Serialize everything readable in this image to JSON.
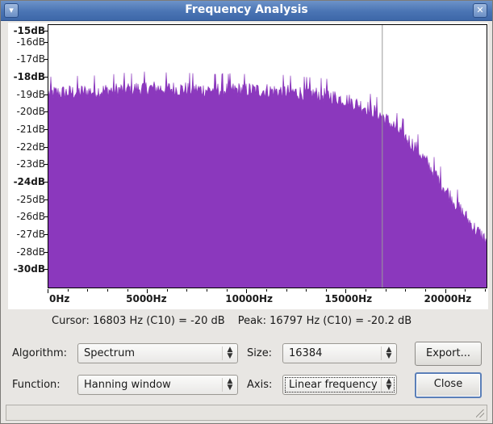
{
  "window": {
    "title": "Frequency Analysis",
    "menu_icon": "window-menu-icon",
    "close_glyph": "✕"
  },
  "chart_data": {
    "type": "area",
    "title": "",
    "xlabel": "",
    "ylabel": "",
    "xlim": [
      0,
      22050
    ],
    "ylim": [
      -30,
      -15
    ],
    "series_color": "#8b38bd",
    "cursor_line_hz": 16803,
    "x_tick_labels": [
      "0Hz",
      "5000Hz",
      "10000Hz",
      "15000Hz",
      "20000Hz"
    ],
    "x_tick_values": [
      0,
      5000,
      10000,
      15000,
      20000
    ],
    "y_tick_labels": [
      "-15dB",
      "-16dB",
      "-17dB",
      "-18dB",
      "-19dB",
      "-20dB",
      "-21dB",
      "-22dB",
      "-23dB",
      "-24dB",
      "-25dB",
      "-26dB",
      "-27dB",
      "-28dB",
      "-30dB"
    ],
    "y_tick_values": [
      -15,
      -16,
      -17,
      -18,
      -19,
      -20,
      -21,
      -22,
      -23,
      -24,
      -25,
      -26,
      -27,
      -28,
      -29
    ],
    "y_bold_labels": [
      "-15dB",
      "-18dB",
      "-24dB",
      "-30dB"
    ],
    "envelope": {
      "x": [
        0,
        2000,
        5000,
        8000,
        10000,
        12000,
        14000,
        15000,
        16000,
        16800,
        17500,
        18500,
        19500,
        20500,
        21500,
        22050
      ],
      "y": [
        -18.9,
        -18.8,
        -18.6,
        -18.7,
        -18.7,
        -18.8,
        -19.0,
        -19.3,
        -19.7,
        -20.2,
        -20.9,
        -22.0,
        -23.6,
        -25.2,
        -26.7,
        -27.3
      ]
    }
  },
  "readout": {
    "cursor": "Cursor: 16803 Hz (C10) = -20 dB",
    "peak": "Peak: 16797 Hz (C10) = -20.2 dB"
  },
  "controls": {
    "algorithm_label": "Algorithm:",
    "algorithm_value": "Spectrum",
    "size_label": "Size:",
    "size_value": "16384",
    "function_label": "Function:",
    "function_value": "Hanning window",
    "axis_label": "Axis:",
    "axis_value": "Linear frequency",
    "export_label": "Export...",
    "close_label": "Close"
  }
}
